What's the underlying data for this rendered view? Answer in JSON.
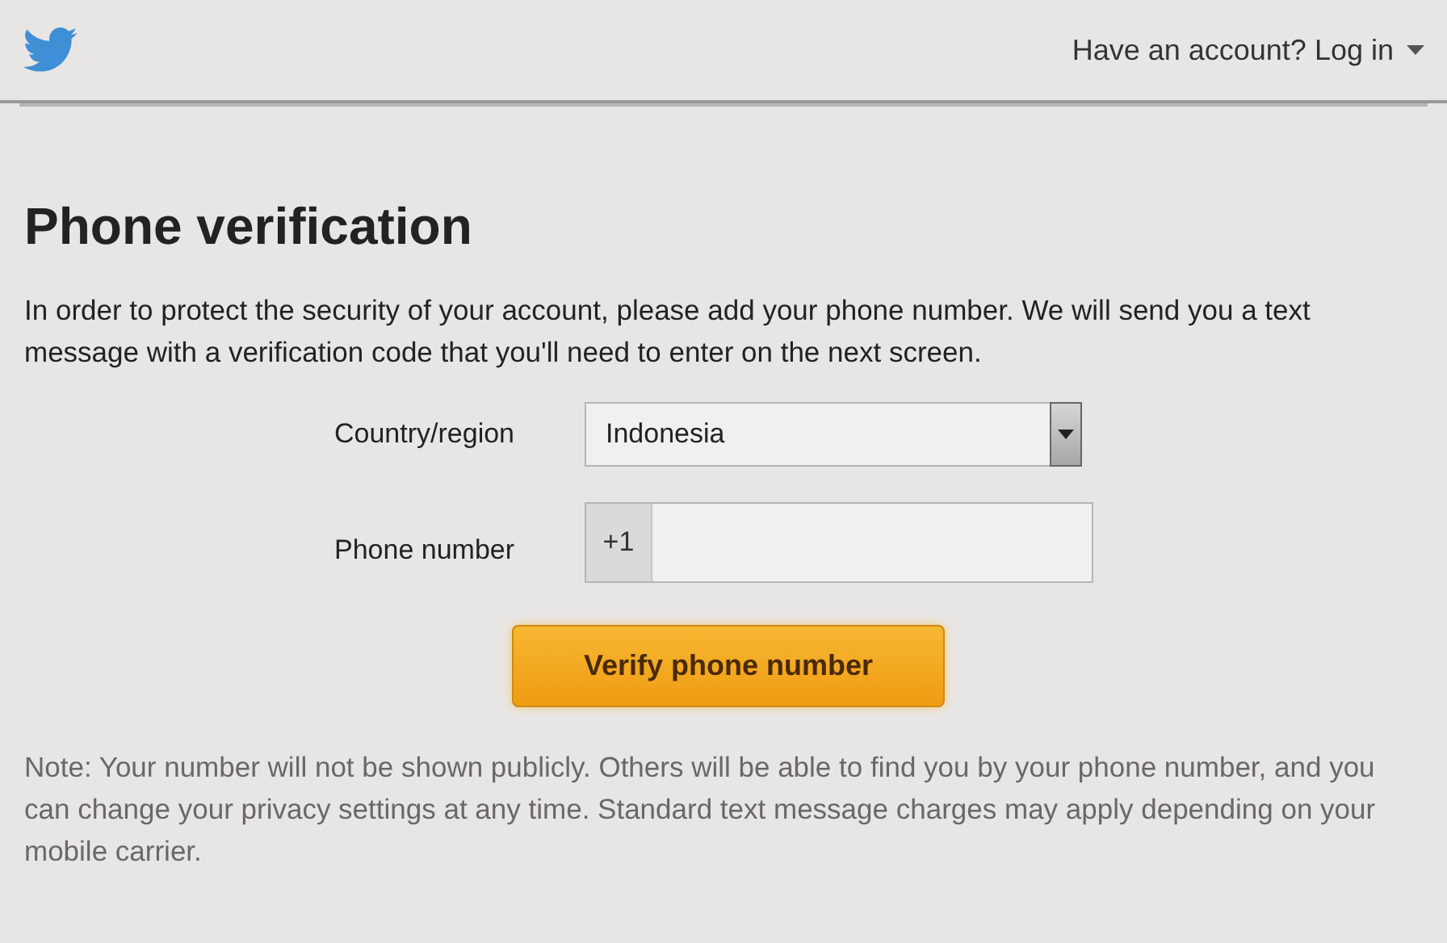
{
  "header": {
    "login_link": "Have an account? Log in"
  },
  "title": "Phone verification",
  "intro": "In order to protect the security of your account, please add your phone number. We will send you a text message with a verification code that you'll need to enter on the next screen.",
  "form": {
    "country": {
      "label": "Country/region",
      "value": "Indonesia"
    },
    "phone": {
      "label": "Phone number",
      "prefix": "+1"
    }
  },
  "submit_button": "Verify phone number",
  "note": "Note: Your number will not be shown publicly. Others will be able to find you by your phone number, and you can change your privacy settings at any time. Standard text message charges may apply depending on your mobile carrier."
}
